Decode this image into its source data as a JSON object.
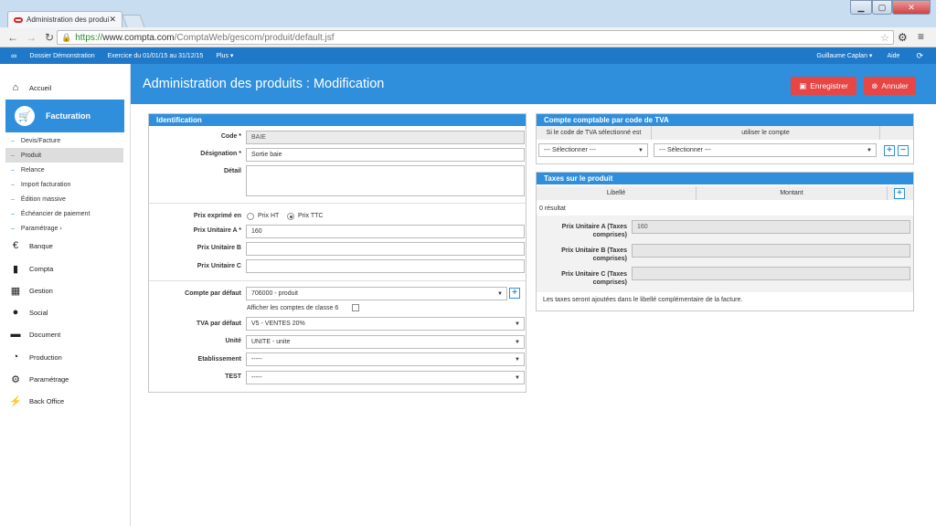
{
  "browser": {
    "tab_title": "Administration des produi",
    "url_https": "https://",
    "url_host": "www.compta.com",
    "url_path": "/ComptaWeb/gescom/produit/default.jsf"
  },
  "topnav": {
    "dossier": "Dossier Démonstration",
    "exercice": "Exercice du 01/01/15 au 31/12/15",
    "plus": "Plus ▾",
    "user": "Guillaume Caplan ▾",
    "aide": "Aide"
  },
  "sidebar": {
    "accueil": "Accueil",
    "facturation": "Facturation",
    "sub": [
      "Devis/Facture",
      "Produit",
      "Relance",
      "Import facturation",
      "Édition massive",
      "Échéancier de paiement",
      "Paramétrage ›"
    ],
    "items": [
      "Banque",
      "Compta",
      "Gestion",
      "Social",
      "Document",
      "Production",
      "Paramétrage",
      "Back Office"
    ]
  },
  "header": {
    "title": "Administration des produits : Modification",
    "save": "Enregistrer",
    "cancel": "Annuler"
  },
  "ident": {
    "title": "Identification",
    "code_label": "Code *",
    "code_value": "BAIE",
    "designation_label": "Désignation *",
    "designation_value": "Sortie baie",
    "detail_label": "Détail",
    "prix_exprime_label": "Prix exprimé en",
    "prix_ht": "Prix HT",
    "prix_ttc": "Prix TTC",
    "pua_label": "Prix Unitaire A *",
    "pua_value": "160",
    "pub_label": "Prix Unitaire B",
    "puc_label": "Prix Unitaire C",
    "compte_label": "Compte par défaut",
    "compte_value": "706000 - produit",
    "afficher_classe6": "Afficher les comptes de classe 6",
    "tva_label": "TVA par défaut",
    "tva_value": "V5 - VENTES 20%",
    "unite_label": "Unité",
    "unite_value": "UNITE - unite",
    "etab_label": "Etablissement",
    "etab_value": "-----",
    "test_label": "TEST",
    "test_value": "-----"
  },
  "tva_panel": {
    "title": "Compte comptable par code de TVA",
    "col1": "Si le code de TVA sélectionné est",
    "col2": "utiliser le compte",
    "sel1": "--- Sélectionner ---",
    "sel2": "--- Sélectionner ---"
  },
  "taxes": {
    "title": "Taxes sur le produit",
    "col_libelle": "Libellé",
    "col_montant": "Montant",
    "result": "0 résultat",
    "pua_label1": "Prix Unitaire A (Taxes",
    "pua_label2": "comprises)",
    "pua_value": "160",
    "pub_label1": "Prix Unitaire B (Taxes",
    "pub_label2": "comprises)",
    "puc_label1": "Prix Unitaire C (Taxes",
    "puc_label2": "comprises)",
    "note": "Les taxes seront ajoutées dans le libellé complémentaire de la facture."
  }
}
